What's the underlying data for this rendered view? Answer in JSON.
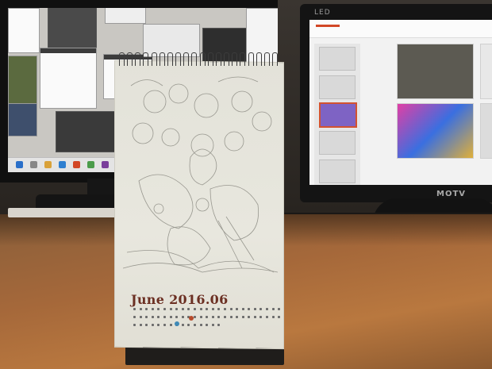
{
  "calendar": {
    "title": "June 2016.06",
    "colors": {
      "title": "#6b2f22",
      "paper": "#e5e4db",
      "marker_red": "#b64a2a",
      "marker_blue": "#3f89b6"
    }
  },
  "monitor_right": {
    "brand_top": "LED",
    "brand_bottom": "MOTV"
  },
  "icons": [
    "spiral-binding-icon",
    "line-art-illustration"
  ]
}
